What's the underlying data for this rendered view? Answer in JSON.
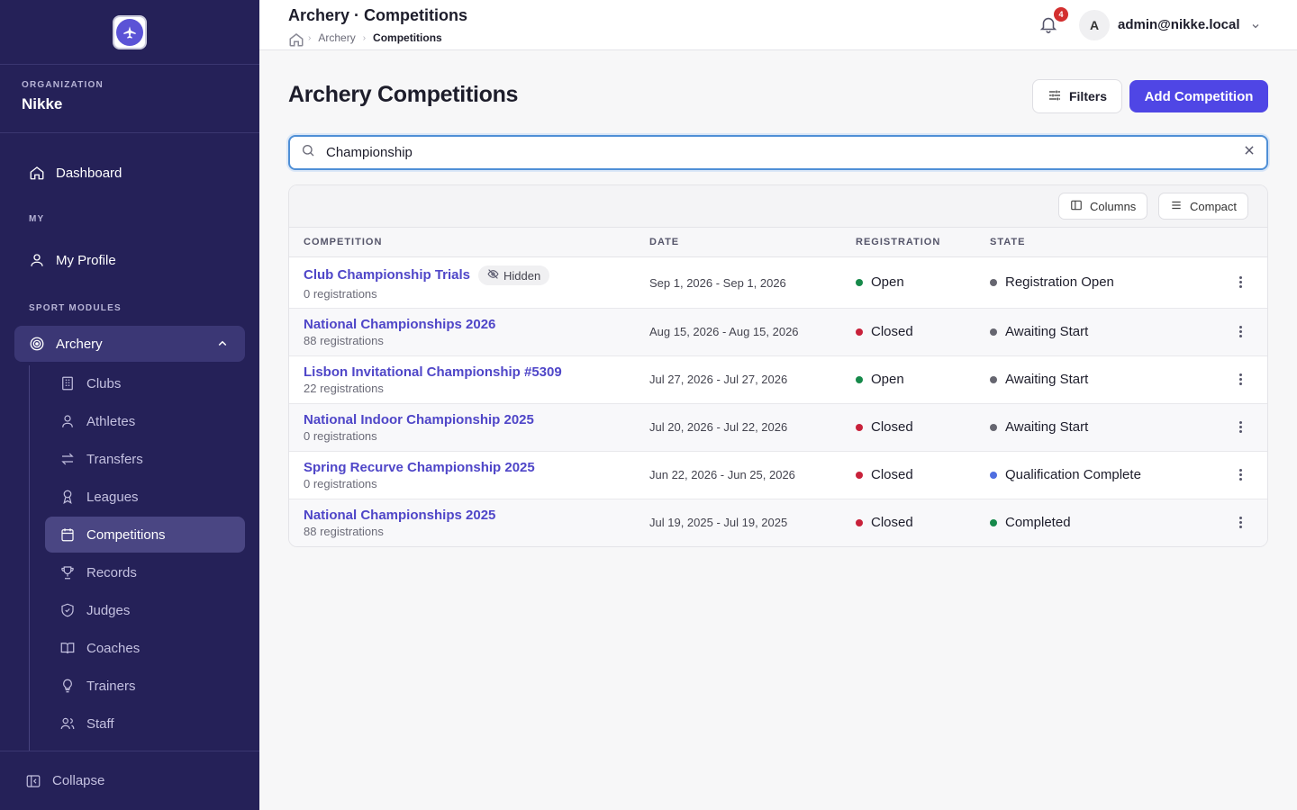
{
  "sidebar": {
    "org_label": "ORGANIZATION",
    "org_name": "Nikke",
    "dashboard": "Dashboard",
    "my_label": "MY",
    "my_profile": "My Profile",
    "sport_label": "SPORT MODULES",
    "archery": "Archery",
    "items": [
      {
        "label": "Clubs",
        "icon": "building-icon"
      },
      {
        "label": "Athletes",
        "icon": "user-icon"
      },
      {
        "label": "Transfers",
        "icon": "transfer-icon"
      },
      {
        "label": "Leagues",
        "icon": "award-icon"
      },
      {
        "label": "Competitions",
        "icon": "calendar-icon",
        "active": true
      },
      {
        "label": "Records",
        "icon": "trophy-icon"
      },
      {
        "label": "Judges",
        "icon": "shield-icon"
      },
      {
        "label": "Coaches",
        "icon": "book-icon"
      },
      {
        "label": "Trainers",
        "icon": "lightbulb-icon"
      },
      {
        "label": "Staff",
        "icon": "users-icon"
      }
    ],
    "collapse": "Collapse"
  },
  "header": {
    "title": "Archery · Competitions",
    "breadcrumb": [
      "Archery",
      "Competitions"
    ],
    "notifications": "4",
    "avatar_initial": "A",
    "user": "admin@nikke.local"
  },
  "page": {
    "title": "Archery Competitions",
    "filters": "Filters",
    "add": "Add Competition",
    "search_value": "Championship"
  },
  "table": {
    "columns_btn": "Columns",
    "compact_btn": "Compact",
    "headers": [
      "COMPETITION",
      "DATE",
      "REGISTRATION",
      "STATE"
    ],
    "rows": [
      {
        "name": "Club Championship Trials",
        "tag": "Hidden",
        "registrations": "0 registrations",
        "date": "Sep 1, 2026 - Sep 1, 2026",
        "registration": "Open",
        "state": "Registration Open"
      },
      {
        "name": "National Championships 2026",
        "registrations": "88 registrations",
        "date": "Aug 15, 2026 - Aug 15, 2026",
        "registration": "Closed",
        "state": "Awaiting Start"
      },
      {
        "name": "Lisbon Invitational Championship #5309",
        "registrations": "22 registrations",
        "date": "Jul 27, 2026 - Jul 27, 2026",
        "registration": "Open",
        "state": "Awaiting Start"
      },
      {
        "name": "National Indoor Championship 2025",
        "registrations": "0 registrations",
        "date": "Jul 20, 2026 - Jul 22, 2026",
        "registration": "Closed",
        "state": "Awaiting Start"
      },
      {
        "name": "Spring Recurve Championship 2025",
        "registrations": "0 registrations",
        "date": "Jun 22, 2026 - Jun 25, 2026",
        "registration": "Closed",
        "state": "Qualification Complete"
      },
      {
        "name": "National Championships 2025",
        "registrations": "88 registrations",
        "date": "Jul 19, 2025 - Jul 19, 2025",
        "registration": "Closed",
        "state": "Completed"
      }
    ]
  },
  "colors": {
    "open": "#16894a",
    "closed": "#c8213a",
    "state_default": "#666670",
    "qualification": "#4f6ee0",
    "completed": "#16894a",
    "accent": "#4f46e5",
    "sidebar": "#252158"
  }
}
